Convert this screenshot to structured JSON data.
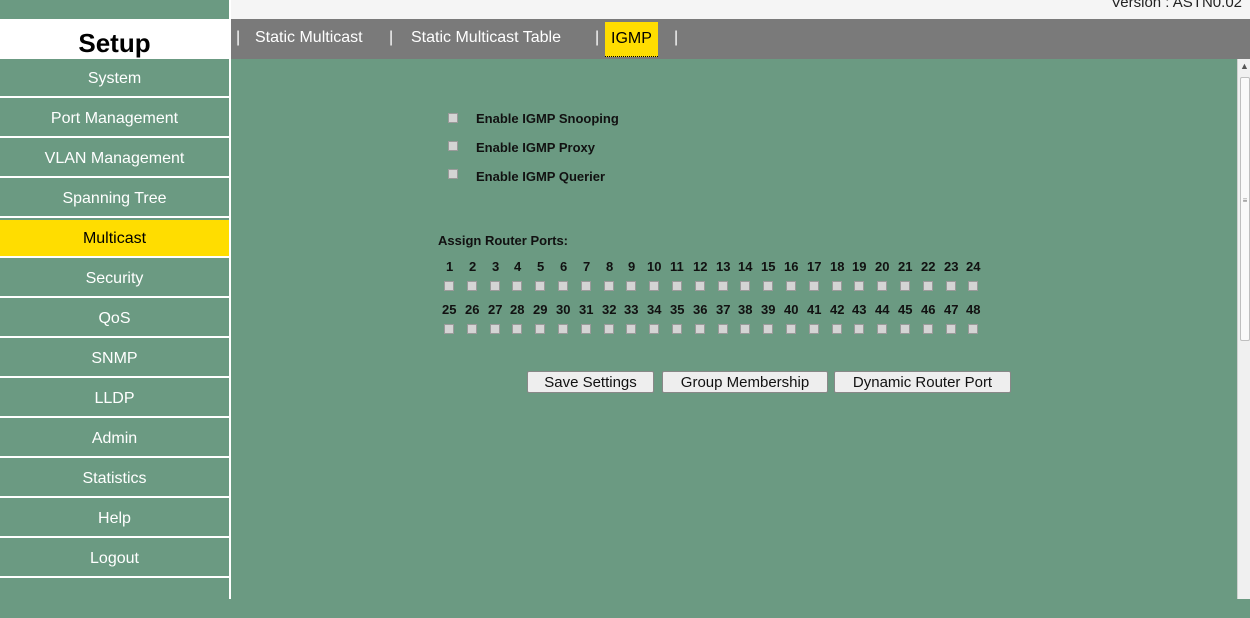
{
  "header": {
    "version_text": "Version : ASTN0.02"
  },
  "sidebar": {
    "title": "Setup",
    "items": [
      {
        "label": "System"
      },
      {
        "label": "Port Management"
      },
      {
        "label": "VLAN Management"
      },
      {
        "label": "Spanning Tree"
      },
      {
        "label": "Multicast",
        "active": true
      },
      {
        "label": "Security"
      },
      {
        "label": "QoS"
      },
      {
        "label": "SNMP"
      },
      {
        "label": "LLDP"
      },
      {
        "label": "Admin"
      },
      {
        "label": "Statistics"
      },
      {
        "label": "Help"
      },
      {
        "label": "Logout"
      }
    ]
  },
  "tabs": [
    {
      "label": "Static Multicast"
    },
    {
      "label": "Static Multicast Table"
    },
    {
      "label": "IGMP",
      "active": true
    }
  ],
  "tab_separator": "|",
  "igmp": {
    "options": [
      {
        "label": "Enable IGMP Snooping",
        "checked": false
      },
      {
        "label": "Enable IGMP Proxy",
        "checked": false
      },
      {
        "label": "Enable IGMP Querier",
        "checked": false
      }
    ],
    "assign_label": "Assign Router Ports:",
    "ports_row1": [
      "1",
      "2",
      "3",
      "4",
      "5",
      "6",
      "7",
      "8",
      "9",
      "10",
      "11",
      "12",
      "13",
      "14",
      "15",
      "16",
      "17",
      "18",
      "19",
      "20",
      "21",
      "22",
      "23",
      "24"
    ],
    "ports_row2": [
      "25",
      "26",
      "27",
      "28",
      "29",
      "30",
      "31",
      "32",
      "33",
      "34",
      "35",
      "36",
      "37",
      "38",
      "39",
      "40",
      "41",
      "42",
      "43",
      "44",
      "45",
      "46",
      "47",
      "48"
    ]
  },
  "buttons": {
    "save": "Save Settings",
    "group": "Group Membership",
    "dynamic": "Dynamic Router Port"
  },
  "colors": {
    "background": "#6b9a82",
    "active_yellow": "#ffdd00",
    "tabbar": "#7a7a7a"
  }
}
